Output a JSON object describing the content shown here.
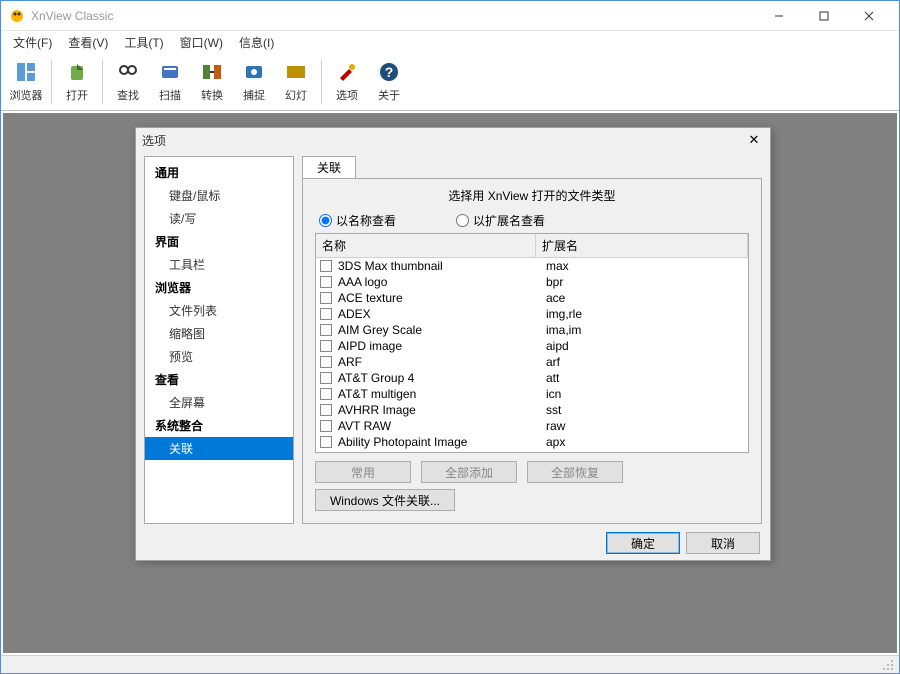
{
  "app": {
    "title": "XnView Classic"
  },
  "menu": {
    "file": "文件(F)",
    "view": "查看(V)",
    "tools": "工具(T)",
    "window": "窗口(W)",
    "info": "信息(I)"
  },
  "toolbar": {
    "browser": "浏览器",
    "open": "打开",
    "find": "查找",
    "scan": "扫描",
    "convert": "转换",
    "capture": "捕捉",
    "slideshow": "幻灯",
    "options": "选项",
    "about": "关于"
  },
  "dialog": {
    "title": "选项",
    "tree": {
      "general": "通用",
      "keyboard_mouse": "键盘/鼠标",
      "read_write": "读/写",
      "interface": "界面",
      "toolbar": "工具栏",
      "browser": "浏览器",
      "file_list": "文件列表",
      "thumbnails": "缩略图",
      "preview": "预览",
      "view": "查看",
      "fullscreen": "全屏幕",
      "system_integration": "系统整合",
      "associations": "关联"
    },
    "tab_label": "关联",
    "heading": "选择用 XnView 打开的文件类型",
    "radio_by_name": "以名称查看",
    "radio_by_ext": "以扩展名查看",
    "col_name": "名称",
    "col_ext": "扩展名",
    "items": [
      {
        "name": "3DS Max thumbnail",
        "ext": "max"
      },
      {
        "name": "AAA logo",
        "ext": "bpr"
      },
      {
        "name": "ACE texture",
        "ext": "ace"
      },
      {
        "name": "ADEX",
        "ext": "img,rle"
      },
      {
        "name": "AIM Grey Scale",
        "ext": "ima,im"
      },
      {
        "name": "AIPD image",
        "ext": "aipd"
      },
      {
        "name": "ARF",
        "ext": "arf"
      },
      {
        "name": "AT&T Group 4",
        "ext": "att"
      },
      {
        "name": "AT&T multigen",
        "ext": "icn"
      },
      {
        "name": "AVHRR Image",
        "ext": "sst"
      },
      {
        "name": "AVT RAW",
        "ext": "raw"
      },
      {
        "name": "Ability Photopaint Image",
        "ext": "apx"
      }
    ],
    "btn_common": "常用",
    "btn_add_all": "全部添加",
    "btn_restore_all": "全部恢复",
    "btn_windows_assoc": "Windows 文件关联...",
    "btn_ok": "确定",
    "btn_cancel": "取消"
  }
}
